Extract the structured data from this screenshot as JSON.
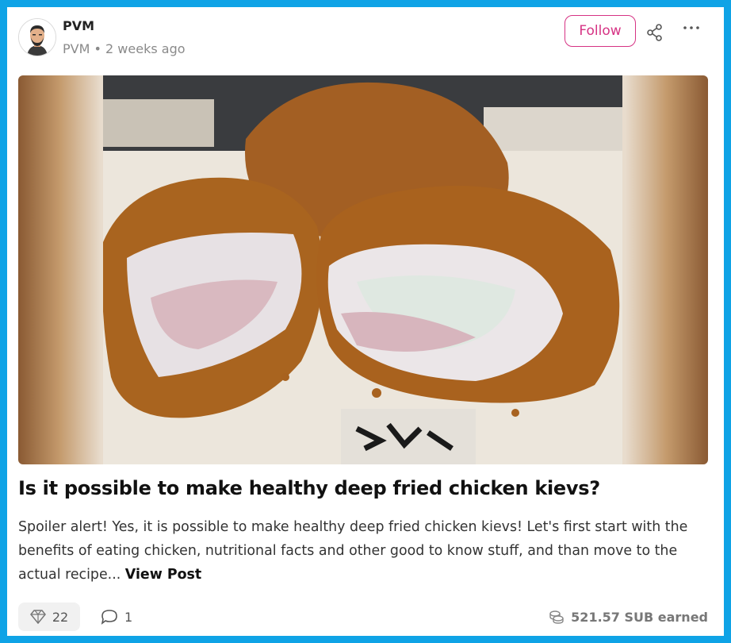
{
  "post": {
    "author": {
      "name": "PVM",
      "handle": "PVM",
      "separator": "•",
      "time_ago": "2 weeks ago"
    },
    "follow_label": "Follow",
    "title": "Is it possible to make healthy deep fried chicken kievs?",
    "excerpt": "Spoiler alert! Yes, it is possible to make healthy deep fried chicken kievs! Let's first start with the benefits of eating chicken, nutritional facts and other good to know stuff, and than move to the actual recipe...",
    "view_post_label": "View Post",
    "upvotes": "22",
    "comments": "1",
    "earned": "521.57 SUB earned"
  },
  "icons": {
    "share": "share-icon",
    "more": "more-icon",
    "upvote": "diamond-icon",
    "comment": "comment-icon",
    "earned": "coins-icon"
  },
  "colors": {
    "accent": "#d63384",
    "frame": "#0fa3e6",
    "text": "#111111",
    "muted": "#8a8a8a"
  }
}
